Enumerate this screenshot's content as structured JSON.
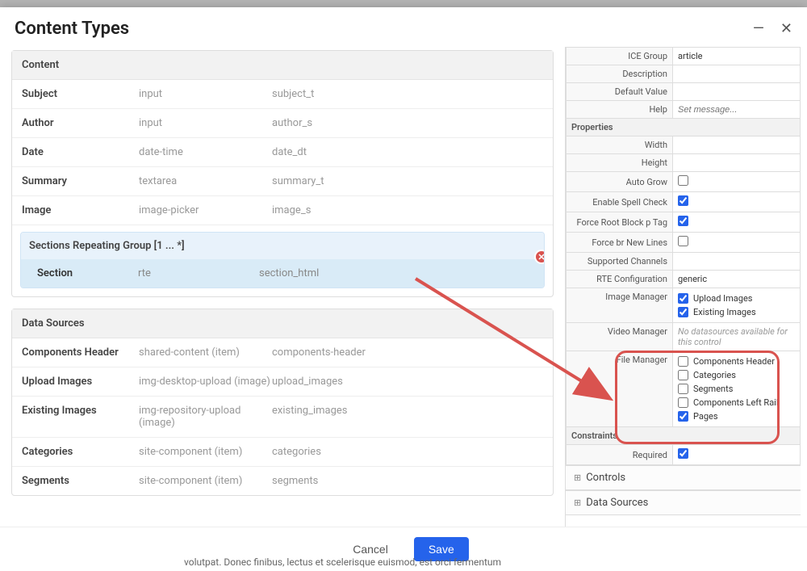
{
  "modal": {
    "title": "Content Types"
  },
  "panels": {
    "content": {
      "title": "Content",
      "rows": [
        {
          "label": "Subject",
          "type": "input",
          "field": "subject_t"
        },
        {
          "label": "Author",
          "type": "input",
          "field": "author_s"
        },
        {
          "label": "Date",
          "type": "date-time",
          "field": "date_dt"
        },
        {
          "label": "Summary",
          "type": "textarea",
          "field": "summary_t"
        },
        {
          "label": "Image",
          "type": "image-picker",
          "field": "image_s"
        }
      ],
      "subgroup": {
        "title": "Sections Repeating Group [1 ... *]",
        "row": {
          "label": "Section",
          "type": "rte",
          "field": "section_html"
        }
      }
    },
    "datasources": {
      "title": "Data Sources",
      "rows": [
        {
          "label": "Components Header",
          "type": "shared-content (item)",
          "field": "components-header"
        },
        {
          "label": "Upload Images",
          "type": "img-desktop-upload (image)",
          "field": "upload_images"
        },
        {
          "label": "Existing Images",
          "type": "img-repository-upload (image)",
          "field": "existing_images"
        },
        {
          "label": "Categories",
          "type": "site-component (item)",
          "field": "categories"
        },
        {
          "label": "Segments",
          "type": "site-component (item)",
          "field": "segments"
        }
      ]
    }
  },
  "right": {
    "basic": [
      {
        "label": "ICE Group",
        "value": "article"
      },
      {
        "label": "Description",
        "value": ""
      },
      {
        "label": "Default Value",
        "value": ""
      },
      {
        "label": "Help",
        "placeholder": "Set message..."
      }
    ],
    "properties_header": "Properties",
    "properties": [
      {
        "label": "Width",
        "value": ""
      },
      {
        "label": "Height",
        "value": ""
      },
      {
        "label": "Auto Grow",
        "checkbox": false
      },
      {
        "label": "Enable Spell Check",
        "checkbox": true
      },
      {
        "label": "Force Root Block p Tag",
        "checkbox": true
      },
      {
        "label": "Force br New Lines",
        "checkbox": false
      },
      {
        "label": "Supported Channels",
        "value": ""
      },
      {
        "label": "RTE Configuration",
        "value": "generic"
      }
    ],
    "image_manager": {
      "label": "Image Manager",
      "options": [
        {
          "label": "Upload Images",
          "checked": true
        },
        {
          "label": "Existing Images",
          "checked": true
        }
      ]
    },
    "video_manager": {
      "label": "Video Manager",
      "message": "No datasources available for this control"
    },
    "file_manager": {
      "label": "File Manager",
      "options": [
        {
          "label": "Components Header",
          "checked": false
        },
        {
          "label": "Categories",
          "checked": false
        },
        {
          "label": "Segments",
          "checked": false
        },
        {
          "label": "Components Left Rail",
          "checked": false
        },
        {
          "label": "Pages",
          "checked": true
        }
      ]
    },
    "constraints_header": "Constraints",
    "constraints": [
      {
        "label": "Required",
        "checkbox": true
      }
    ],
    "collapsed": [
      "Controls",
      "Data Sources"
    ]
  },
  "footer": {
    "cancel": "Cancel",
    "save": "Save"
  },
  "background_text": "volutpat. Donec finibus, lectus et scelerisque euismod, est orci fermentum"
}
